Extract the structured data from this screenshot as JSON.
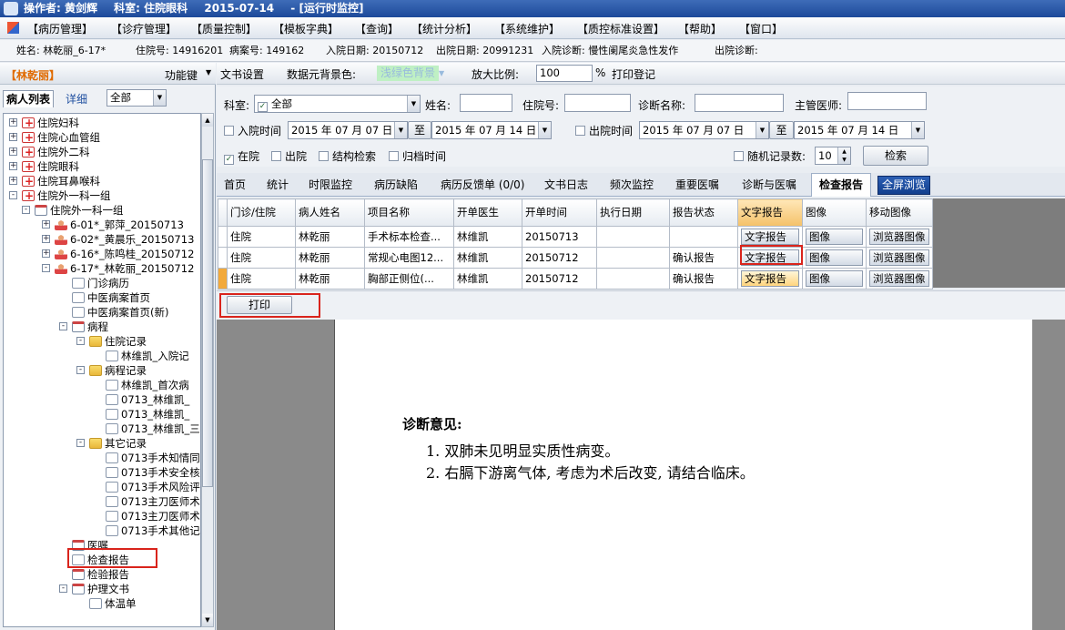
{
  "titlebar": {
    "operator": "操作者: 黄剑辉",
    "department": "科室: 住院眼科",
    "date": "2015-07-14",
    "mode": "-  [运行时监控]"
  },
  "menu": [
    "【病历管理】",
    "【诊疗管理】",
    "【质量控制】",
    "【模板字典】",
    "【查询】",
    "【统计分析】",
    "【系统维护】",
    "【质控标准设置】",
    "【帮助】",
    "【窗口】"
  ],
  "patient": {
    "name": "姓名: 林乾丽_6-17*",
    "inpatient_no": "住院号: 14916201",
    "case_no": "病案号: 149162",
    "admit_date": "入院日期: 20150712",
    "discharge_date": "出院日期: 20991231",
    "admit_diag": "入院诊断: 慢性阑尾炎急性发作",
    "discharge_diag": "出院诊断:"
  },
  "left": {
    "current_patient": "【林乾丽】",
    "func_label": "功能键",
    "tabs": [
      "病人列表",
      "详细"
    ],
    "scope": "全部"
  },
  "tree": [
    {
      "label": "住院妇科",
      "level": 0,
      "icon": "ward-icon",
      "exp": "+"
    },
    {
      "label": "住院心血管组",
      "level": 0,
      "icon": "ward-icon",
      "exp": "+"
    },
    {
      "label": "住院外二科",
      "level": 0,
      "icon": "ward-icon",
      "exp": "+"
    },
    {
      "label": "住院眼科",
      "level": 0,
      "icon": "ward-icon",
      "exp": "+"
    },
    {
      "label": "住院耳鼻喉科",
      "level": 0,
      "icon": "ward-icon",
      "exp": "+"
    },
    {
      "label": "住院外一科一组",
      "level": 0,
      "icon": "ward-icon",
      "exp": "-"
    },
    {
      "label": "住院外一科一组",
      "level": 1,
      "icon": "department-icon",
      "exp": "-"
    },
    {
      "label": "6-01*_郭萍_20150713",
      "level": 2,
      "icon": "patient-icon",
      "exp": "+"
    },
    {
      "label": "6-02*_黄晨乐_20150713",
      "level": 2,
      "icon": "patient-icon",
      "exp": "+"
    },
    {
      "label": "6-16*_陈鸣桂_20150712",
      "level": 2,
      "icon": "patient-icon",
      "exp": "+"
    },
    {
      "label": "6-17*_林乾丽_20150712",
      "level": 2,
      "icon": "patient-icon",
      "exp": "-"
    },
    {
      "label": "门诊病历",
      "level": 3,
      "icon": "document-icon",
      "exp": ""
    },
    {
      "label": "中医病案首页",
      "level": 3,
      "icon": "document-icon",
      "exp": ""
    },
    {
      "label": "中医病案首页(新)",
      "level": 3,
      "icon": "document-icon",
      "exp": ""
    },
    {
      "label": "病程",
      "level": 3,
      "icon": "calendar-icon",
      "exp": "-"
    },
    {
      "label": "住院记录",
      "level": 4,
      "icon": "folder-icon",
      "exp": "-"
    },
    {
      "label": "林维凯_入院记",
      "level": 5,
      "icon": "document-icon",
      "exp": ""
    },
    {
      "label": "病程记录",
      "level": 4,
      "icon": "folder-icon",
      "exp": "-"
    },
    {
      "label": "林维凯_首次病",
      "level": 5,
      "icon": "document-icon",
      "exp": ""
    },
    {
      "label": "0713_林维凯_",
      "level": 5,
      "icon": "document-icon",
      "exp": ""
    },
    {
      "label": "0713_林维凯_",
      "level": 5,
      "icon": "document-icon",
      "exp": ""
    },
    {
      "label": "0713_林维凯_三",
      "level": 5,
      "icon": "document-icon",
      "exp": ""
    },
    {
      "label": "其它记录",
      "level": 4,
      "icon": "folder-icon",
      "exp": "-"
    },
    {
      "label": "0713手术知情同",
      "level": 5,
      "icon": "document-icon",
      "exp": ""
    },
    {
      "label": "0713手术安全核",
      "level": 5,
      "icon": "document-icon",
      "exp": ""
    },
    {
      "label": "0713手术风险评",
      "level": 5,
      "icon": "document-icon",
      "exp": ""
    },
    {
      "label": "0713主刀医师术",
      "level": 5,
      "icon": "document-icon",
      "exp": ""
    },
    {
      "label": "0713主刀医师术",
      "level": 5,
      "icon": "document-icon",
      "exp": ""
    },
    {
      "label": "0713手术其他记",
      "level": 5,
      "icon": "document-icon",
      "exp": ""
    },
    {
      "label": "医嘱",
      "level": 3,
      "icon": "order-icon",
      "exp": ""
    },
    {
      "label": "检查报告",
      "level": 3,
      "icon": "report-icon",
      "exp": ""
    },
    {
      "label": "检验报告",
      "level": 3,
      "icon": "lab-icon",
      "exp": ""
    },
    {
      "label": "护理文书",
      "level": 3,
      "icon": "calendar-icon",
      "exp": "-"
    },
    {
      "label": "体温单",
      "level": 4,
      "icon": "document-icon",
      "exp": ""
    }
  ],
  "toolbar": {
    "doc_settings": "文书设置",
    "bg_label": "数据元背景色:",
    "bg_value": "浅绿色背景",
    "zoom_label": "放大比例:",
    "zoom_value": "100",
    "percent": "%",
    "print_register": "打印登记"
  },
  "filter": {
    "dept_label": "科室:",
    "dept_value": "全部",
    "name_label": "姓名:",
    "inpatient_label": "住院号:",
    "diag_label": "诊断名称:",
    "doctor_label": "主管医师:",
    "admit_time_label": "入院时间",
    "date_from": "2015 年 07 月 07 日",
    "to": "至",
    "date_to": "2015 年 07 月 14 日",
    "discharge_time_label": "出院时间",
    "d_date_from": "2015 年 07 月 07 日",
    "d_date_to": "2015 年 07 月 14 日",
    "in_hospital": "在院",
    "discharged": "出院",
    "struct_search": "结构检索",
    "archive_time": "归档时间",
    "random_label": "随机记录数:",
    "random_value": "10",
    "search_btn": "检索"
  },
  "tabs": [
    "首页",
    "统计",
    "时限监控",
    "病历缺陷",
    "病历反馈单 (0/0)",
    "文书日志",
    "频次监控",
    "重要医嘱",
    "诊断与医嘱",
    "检查报告",
    "全屏浏览"
  ],
  "grid": {
    "headers": [
      "门诊/住院",
      "病人姓名",
      "项目名称",
      "开单医生",
      "开单时间",
      "执行日期",
      "报告状态",
      "文字报告",
      "图像",
      "移动图像"
    ],
    "rows": [
      [
        "住院",
        "林乾丽",
        "手术标本检查...",
        "林维凯",
        "20150713",
        "",
        "",
        "文字报告",
        "图像",
        "浏览器图像"
      ],
      [
        "住院",
        "林乾丽",
        "常规心电图12...",
        "林维凯",
        "20150712",
        "",
        "确认报告",
        "文字报告",
        "图像",
        "浏览器图像"
      ],
      [
        "住院",
        "林乾丽",
        "胸部正侧位(...",
        "林维凯",
        "20150712",
        "",
        "确认报告",
        "文字报告",
        "图像",
        "浏览器图像"
      ]
    ]
  },
  "print_btn": "打印",
  "report": {
    "heading": "诊断意见:",
    "lines": [
      "1. 双肺未见明显实质性病变。",
      "2. 右膈下游离气体, 考虑为术后改变, 请结合临床。"
    ]
  }
}
